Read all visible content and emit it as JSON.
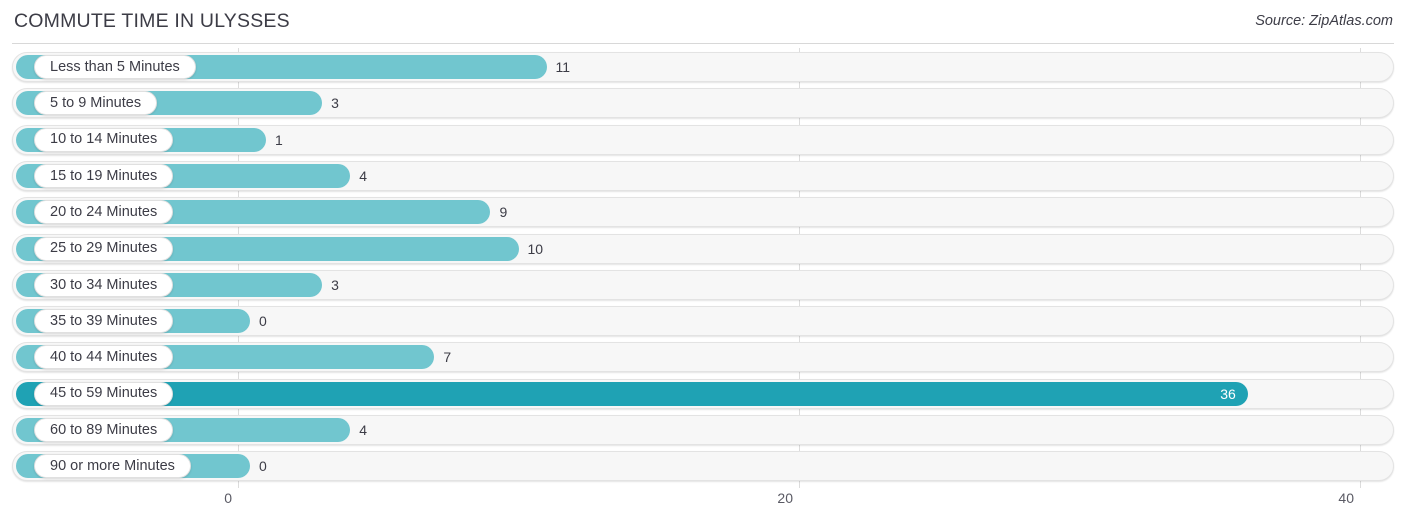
{
  "header": {
    "title": "COMMUTE TIME IN ULYSSES",
    "source": "Source: ZipAtlas.com"
  },
  "chart_data": {
    "type": "bar",
    "orientation": "horizontal",
    "title": "COMMUTE TIME IN ULYSSES",
    "xlabel": "",
    "ylabel": "",
    "xlim": [
      0,
      40
    ],
    "xticks": [
      0,
      20,
      40
    ],
    "xtick_labels": [
      "0",
      "20",
      "40"
    ],
    "grid": true,
    "legend": null,
    "highlight_color": "#1fa2b4",
    "bar_color": "#71c6cf",
    "track_color": "#f7f7f7",
    "highlighted_category": "45 to 59 Minutes",
    "categories": [
      "Less than 5 Minutes",
      "5 to 9 Minutes",
      "10 to 14 Minutes",
      "15 to 19 Minutes",
      "20 to 24 Minutes",
      "25 to 29 Minutes",
      "30 to 34 Minutes",
      "35 to 39 Minutes",
      "40 to 44 Minutes",
      "45 to 59 Minutes",
      "60 to 89 Minutes",
      "90 or more Minutes"
    ],
    "values": [
      11,
      3,
      1,
      4,
      9,
      10,
      3,
      0,
      7,
      36,
      4,
      0
    ],
    "value_labels": [
      "11",
      "3",
      "1",
      "4",
      "9",
      "10",
      "3",
      "0",
      "7",
      "36",
      "4",
      "0"
    ]
  }
}
